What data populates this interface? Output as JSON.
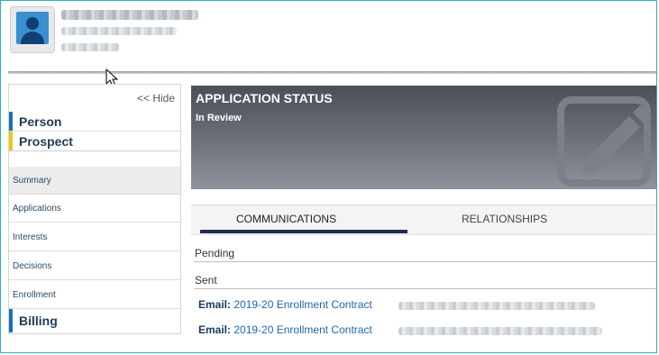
{
  "sidebar": {
    "hide_label": "<< Hide",
    "sections": [
      {
        "label": "Person"
      },
      {
        "label": "Prospect"
      }
    ],
    "items": [
      {
        "label": "Summary"
      },
      {
        "label": "Applications"
      },
      {
        "label": "Interests"
      },
      {
        "label": "Decisions"
      },
      {
        "label": "Enrollment"
      }
    ],
    "billing_label": "Billing"
  },
  "status": {
    "title": "APPLICATION STATUS",
    "value": "In Review"
  },
  "tabs": [
    {
      "label": "COMMUNICATIONS",
      "active": true
    },
    {
      "label": "RELATIONSHIPS",
      "active": false
    }
  ],
  "communications": {
    "pending_label": "Pending",
    "sent_label": "Sent",
    "emails": [
      {
        "prefix": "Email:",
        "subject": "2019-20 Enrollment Contract"
      },
      {
        "prefix": "Email:",
        "subject": "2019-20 Enrollment Contract"
      }
    ]
  },
  "icons": {
    "avatar": "user-avatar-icon",
    "status_decoration": "pencil-edit-icon",
    "cursor": "mouse-pointer-icon"
  },
  "colors": {
    "accent_blue": "#1a6ebf",
    "accent_yellow": "#f0c419",
    "tab_underline": "#1e2f4c",
    "link": "#1f66b3",
    "frame_border": "#2ab3b8"
  }
}
